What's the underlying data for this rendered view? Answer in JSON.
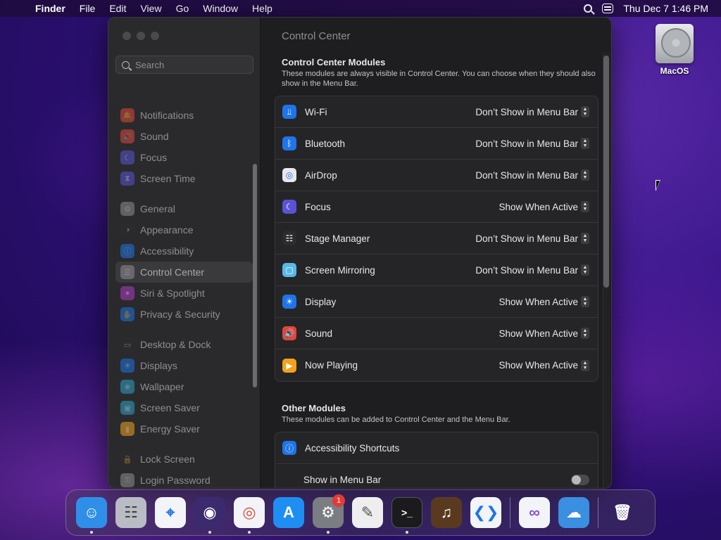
{
  "menubar": {
    "app_name": "Finder",
    "menus": [
      "File",
      "Edit",
      "View",
      "Go",
      "Window",
      "Help"
    ],
    "datetime": "Thu Dec 7  1:46 PM"
  },
  "desktop": {
    "drive_label": "MacOS"
  },
  "window": {
    "search_placeholder": "Search",
    "sidebar": [
      {
        "label": "Notifications",
        "icon": "bell-icon",
        "color": "#e0463d"
      },
      {
        "label": "Sound",
        "icon": "speaker-icon",
        "color": "#e0463d"
      },
      {
        "label": "Focus",
        "icon": "moon-icon",
        "color": "#5b52d6"
      },
      {
        "label": "Screen Time",
        "icon": "hourglass-icon",
        "color": "#5b52d6"
      },
      {
        "label": "General",
        "icon": "gear-icon",
        "color": "#8e8e93"
      },
      {
        "label": "Appearance",
        "icon": "appearance-icon",
        "color": "#2c2c2e"
      },
      {
        "label": "Accessibility",
        "icon": "accessibility-icon",
        "color": "#1e74e8"
      },
      {
        "label": "Control Center",
        "icon": "control-center-icon",
        "color": "#8e8e93"
      },
      {
        "label": "Siri & Spotlight",
        "icon": "siri-icon",
        "color": "#b13cc9"
      },
      {
        "label": "Privacy & Security",
        "icon": "hand-icon",
        "color": "#1e74e8"
      },
      {
        "label": "Desktop & Dock",
        "icon": "dock-icon",
        "color": "#2c2c2e"
      },
      {
        "label": "Displays",
        "icon": "sun-icon",
        "color": "#1e74e8"
      },
      {
        "label": "Wallpaper",
        "icon": "wallpaper-icon",
        "color": "#2aa3c7"
      },
      {
        "label": "Screen Saver",
        "icon": "screensaver-icon",
        "color": "#2aa3c7"
      },
      {
        "label": "Energy Saver",
        "icon": "battery-icon",
        "color": "#f2a31b"
      },
      {
        "label": "Lock Screen",
        "icon": "lock-icon",
        "color": "#2c2c2e"
      },
      {
        "label": "Login Password",
        "icon": "key-icon",
        "color": "#8e8e93"
      }
    ],
    "active_item": "Control Center",
    "title": "Control Center",
    "modules_section": {
      "title": "Control Center Modules",
      "description": "These modules are always visible in Control Center. You can choose when they should also show in the Menu Bar.",
      "rows": [
        {
          "name": "Wi-Fi",
          "value": "Don’t Show in Menu Bar",
          "icon": "wifi-icon",
          "color": "#1e74e8"
        },
        {
          "name": "Bluetooth",
          "value": "Don’t Show in Menu Bar",
          "icon": "bluetooth-icon",
          "color": "#1e74e8"
        },
        {
          "name": "AirDrop",
          "value": "Don’t Show in Menu Bar",
          "icon": "airdrop-icon",
          "color": "#e8e8ea"
        },
        {
          "name": "Focus",
          "value": "Show When Active",
          "icon": "moon-icon",
          "color": "#5b52d6"
        },
        {
          "name": "Stage Manager",
          "value": "Don’t Show in Menu Bar",
          "icon": "stage-manager-icon",
          "color": "#2c2c2e"
        },
        {
          "name": "Screen Mirroring",
          "value": "Don’t Show in Menu Bar",
          "icon": "screen-mirroring-icon",
          "color": "#58b8e6"
        },
        {
          "name": "Display",
          "value": "Show When Active",
          "icon": "sun-icon",
          "color": "#1e74e8"
        },
        {
          "name": "Sound",
          "value": "Show When Active",
          "icon": "speaker-icon",
          "color": "#e0463d"
        },
        {
          "name": "Now Playing",
          "value": "Show When Active",
          "icon": "play-icon",
          "color": "#f2a31b"
        }
      ]
    },
    "other_section": {
      "title": "Other Modules",
      "description": "These modules can be added to Control Center and the Menu Bar.",
      "rows": [
        {
          "name": "Accessibility Shortcuts",
          "icon": "accessibility-icon",
          "color": "#1e74e8"
        }
      ],
      "subrow_label": "Show in Menu Bar",
      "subrow_toggle_on": false
    }
  },
  "dock": {
    "apps": [
      {
        "name": "Finder",
        "icon": "finder-icon",
        "running": true,
        "color": "#2f8fe8"
      },
      {
        "name": "Launchpad",
        "icon": "launchpad-icon",
        "running": false,
        "color": "#b9bcc4"
      },
      {
        "name": "Safari",
        "icon": "safari-icon",
        "running": false,
        "color": "#f2f4f7"
      },
      {
        "name": "Firefox",
        "icon": "firefox-icon",
        "running": true,
        "color": "#3b2a6e"
      },
      {
        "name": "Chrome",
        "icon": "chrome-icon",
        "running": true,
        "color": "#f2f4f7"
      },
      {
        "name": "App Store",
        "icon": "app-store-icon",
        "running": false,
        "color": "#1e8ef2"
      },
      {
        "name": "System Settings",
        "icon": "system-settings-icon",
        "running": true,
        "color": "#7a7d82",
        "badge": "1"
      },
      {
        "name": "TextEdit",
        "icon": "textedit-icon",
        "running": false,
        "color": "#eeeeee"
      },
      {
        "name": "Terminal",
        "icon": "terminal-icon",
        "running": true,
        "color": "#1b1b1d"
      },
      {
        "name": "GarageBand",
        "icon": "garageband-icon",
        "running": false,
        "color": "#5a3a1e"
      },
      {
        "name": "VS Code",
        "icon": "vscode-icon",
        "running": false,
        "color": "#f2f4f7"
      }
    ],
    "recent": [
      {
        "name": "Visual Studio",
        "icon": "visual-studio-icon",
        "running": false,
        "color": "#f2f4f7"
      },
      {
        "name": "Weather",
        "icon": "weather-icon",
        "running": false,
        "color": "#3a8fe0"
      }
    ],
    "trash": {
      "name": "Trash",
      "icon": "trash-icon"
    }
  }
}
